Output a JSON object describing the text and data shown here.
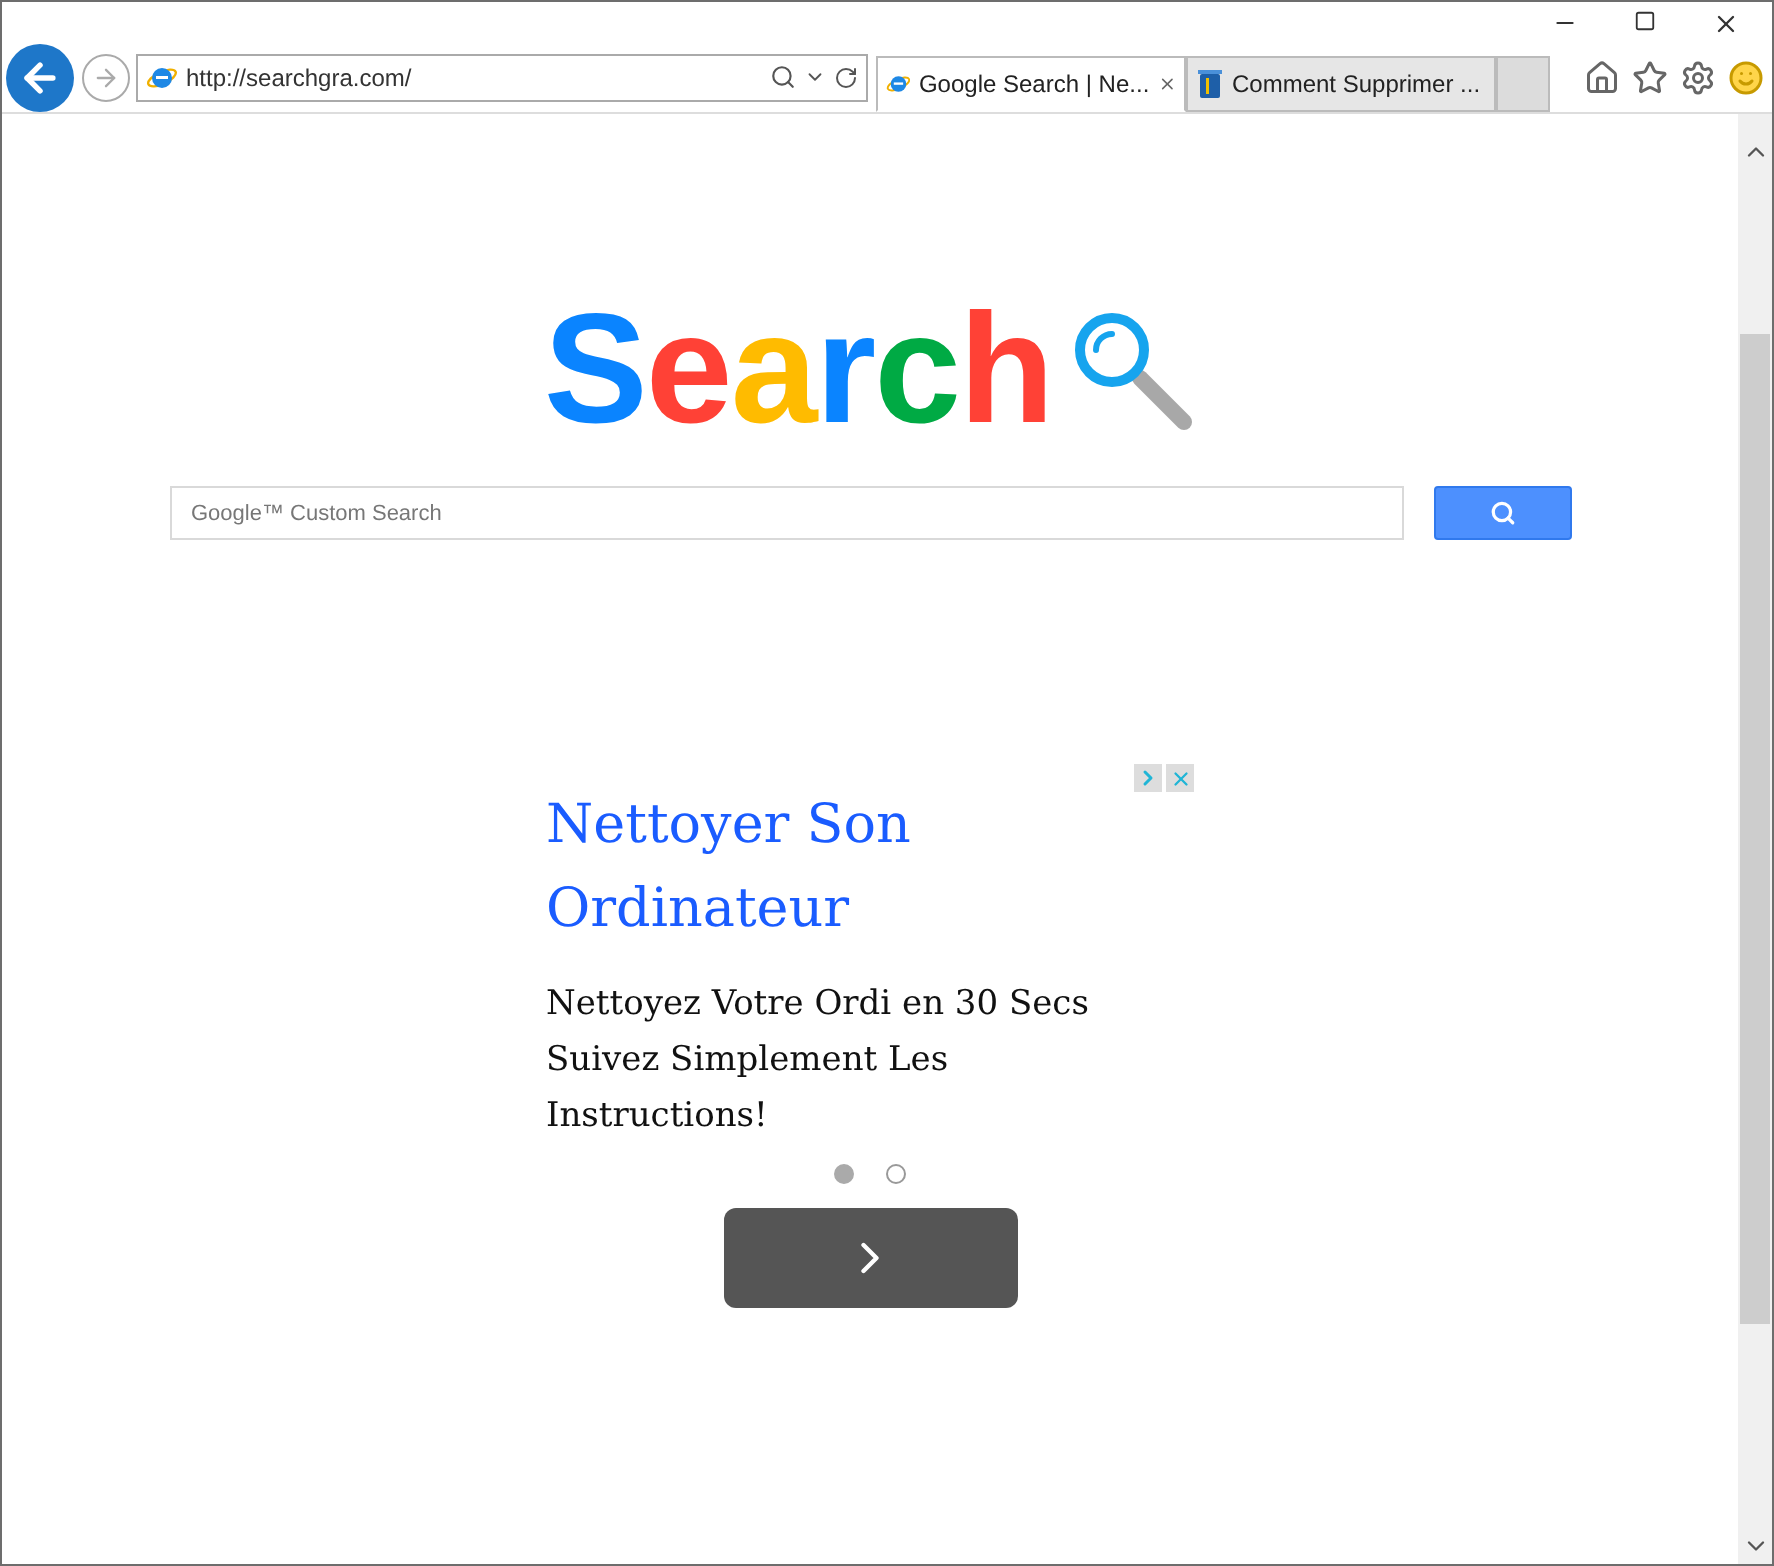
{
  "address_bar": {
    "url": "http://searchgra.com/"
  },
  "tabs": [
    {
      "label": "Google Search | Ne...",
      "selected": true,
      "closable": true,
      "kind": "ie"
    },
    {
      "label": "Comment Supprimer ...",
      "selected": false,
      "closable": false,
      "kind": "bin"
    }
  ],
  "logo": {
    "letters": [
      {
        "text": "S",
        "color": "#0a84ff"
      },
      {
        "text": "e",
        "color": "#ff4136"
      },
      {
        "text": "a",
        "color": "#ffbb00"
      },
      {
        "text": "r",
        "color": "#0a84ff"
      },
      {
        "text": "c",
        "color": "#00aa44"
      },
      {
        "text": "h",
        "color": "#ff4136"
      }
    ]
  },
  "search": {
    "placeholder": "Google™ Custom Search"
  },
  "ad": {
    "title": "Nettoyer Son Ordinateur",
    "body": "Nettoyez Votre Ordi en 30 Secs Suivez Simplement Les Instructions!",
    "dots": [
      {
        "selected": true
      },
      {
        "selected": false
      }
    ]
  }
}
